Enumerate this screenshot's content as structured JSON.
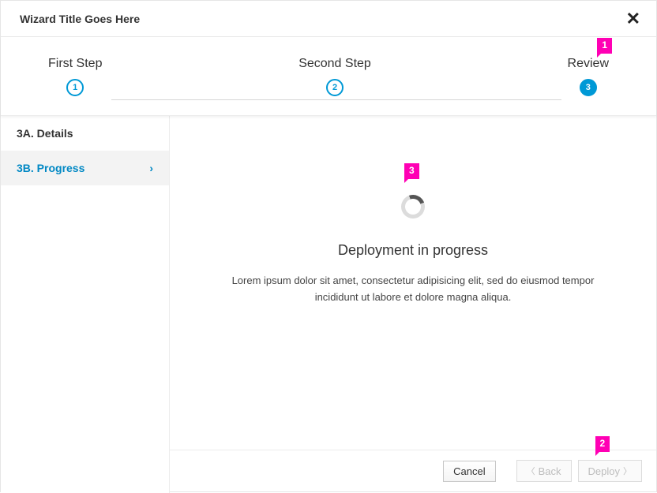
{
  "header": {
    "title": "Wizard Title Goes Here"
  },
  "steps": [
    {
      "label": "First Step",
      "num": "1"
    },
    {
      "label": "Second Step",
      "num": "2"
    },
    {
      "label": "Review",
      "num": "3"
    }
  ],
  "sidebar": {
    "items": [
      {
        "label": "3A. Details"
      },
      {
        "label": "3B. Progress"
      }
    ]
  },
  "main": {
    "title": "Deployment in progress",
    "desc": "Lorem ipsum dolor sit amet, consectetur adipisicing elit, sed do eiusmod tempor incididunt ut labore et dolore magna aliqua."
  },
  "footer": {
    "cancel": "Cancel",
    "back": "Back",
    "deploy": "Deploy"
  },
  "markers": {
    "m1": "1",
    "m2": "2",
    "m3": "3"
  }
}
